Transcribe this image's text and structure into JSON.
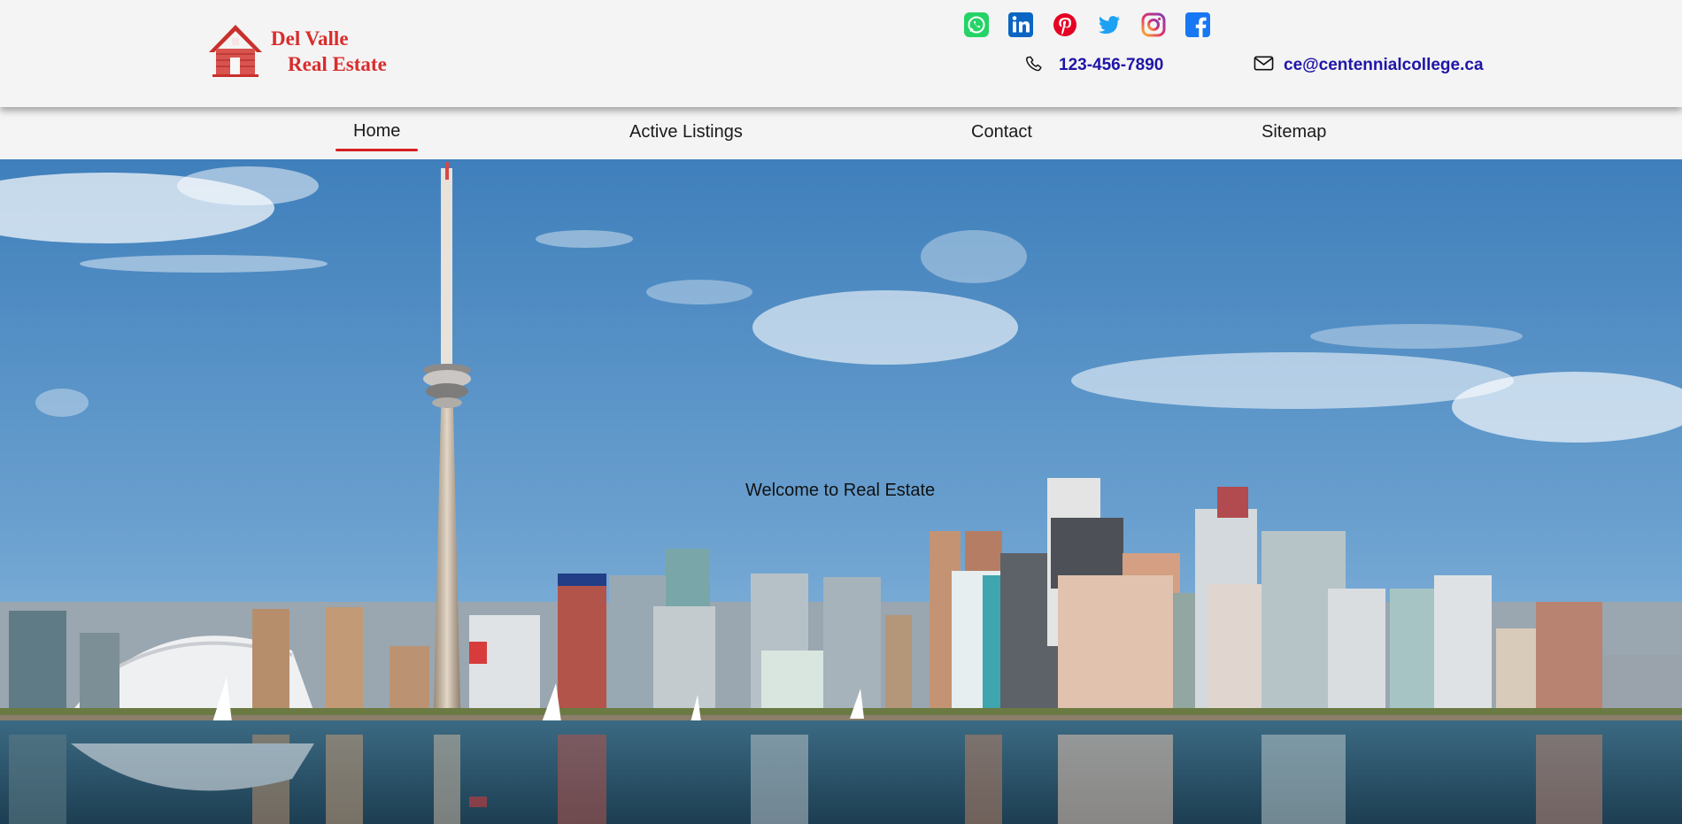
{
  "brand": {
    "line1": "Del Valle",
    "line2": "Real Estate",
    "color": "#d82d2d"
  },
  "social": [
    {
      "name": "whatsapp-icon",
      "color": "#25d366"
    },
    {
      "name": "linkedin-icon",
      "color": "#0a66c2"
    },
    {
      "name": "pinterest-icon",
      "color": "#e60023"
    },
    {
      "name": "twitter-icon",
      "color": "#1da1f2"
    },
    {
      "name": "instagram-icon",
      "color": "#e1306c"
    },
    {
      "name": "facebook-icon",
      "color": "#1877f2"
    }
  ],
  "contact": {
    "phone": "123-456-7890",
    "email": "ce@centennialcollege.ca",
    "color": "#1f15a8"
  },
  "nav": {
    "items": [
      "Home",
      "Active Listings",
      "Contact",
      "Sitemap"
    ],
    "active": "Home",
    "accent": "#d61f1f"
  },
  "hero": {
    "welcome": "Welcome to Real Estate"
  }
}
